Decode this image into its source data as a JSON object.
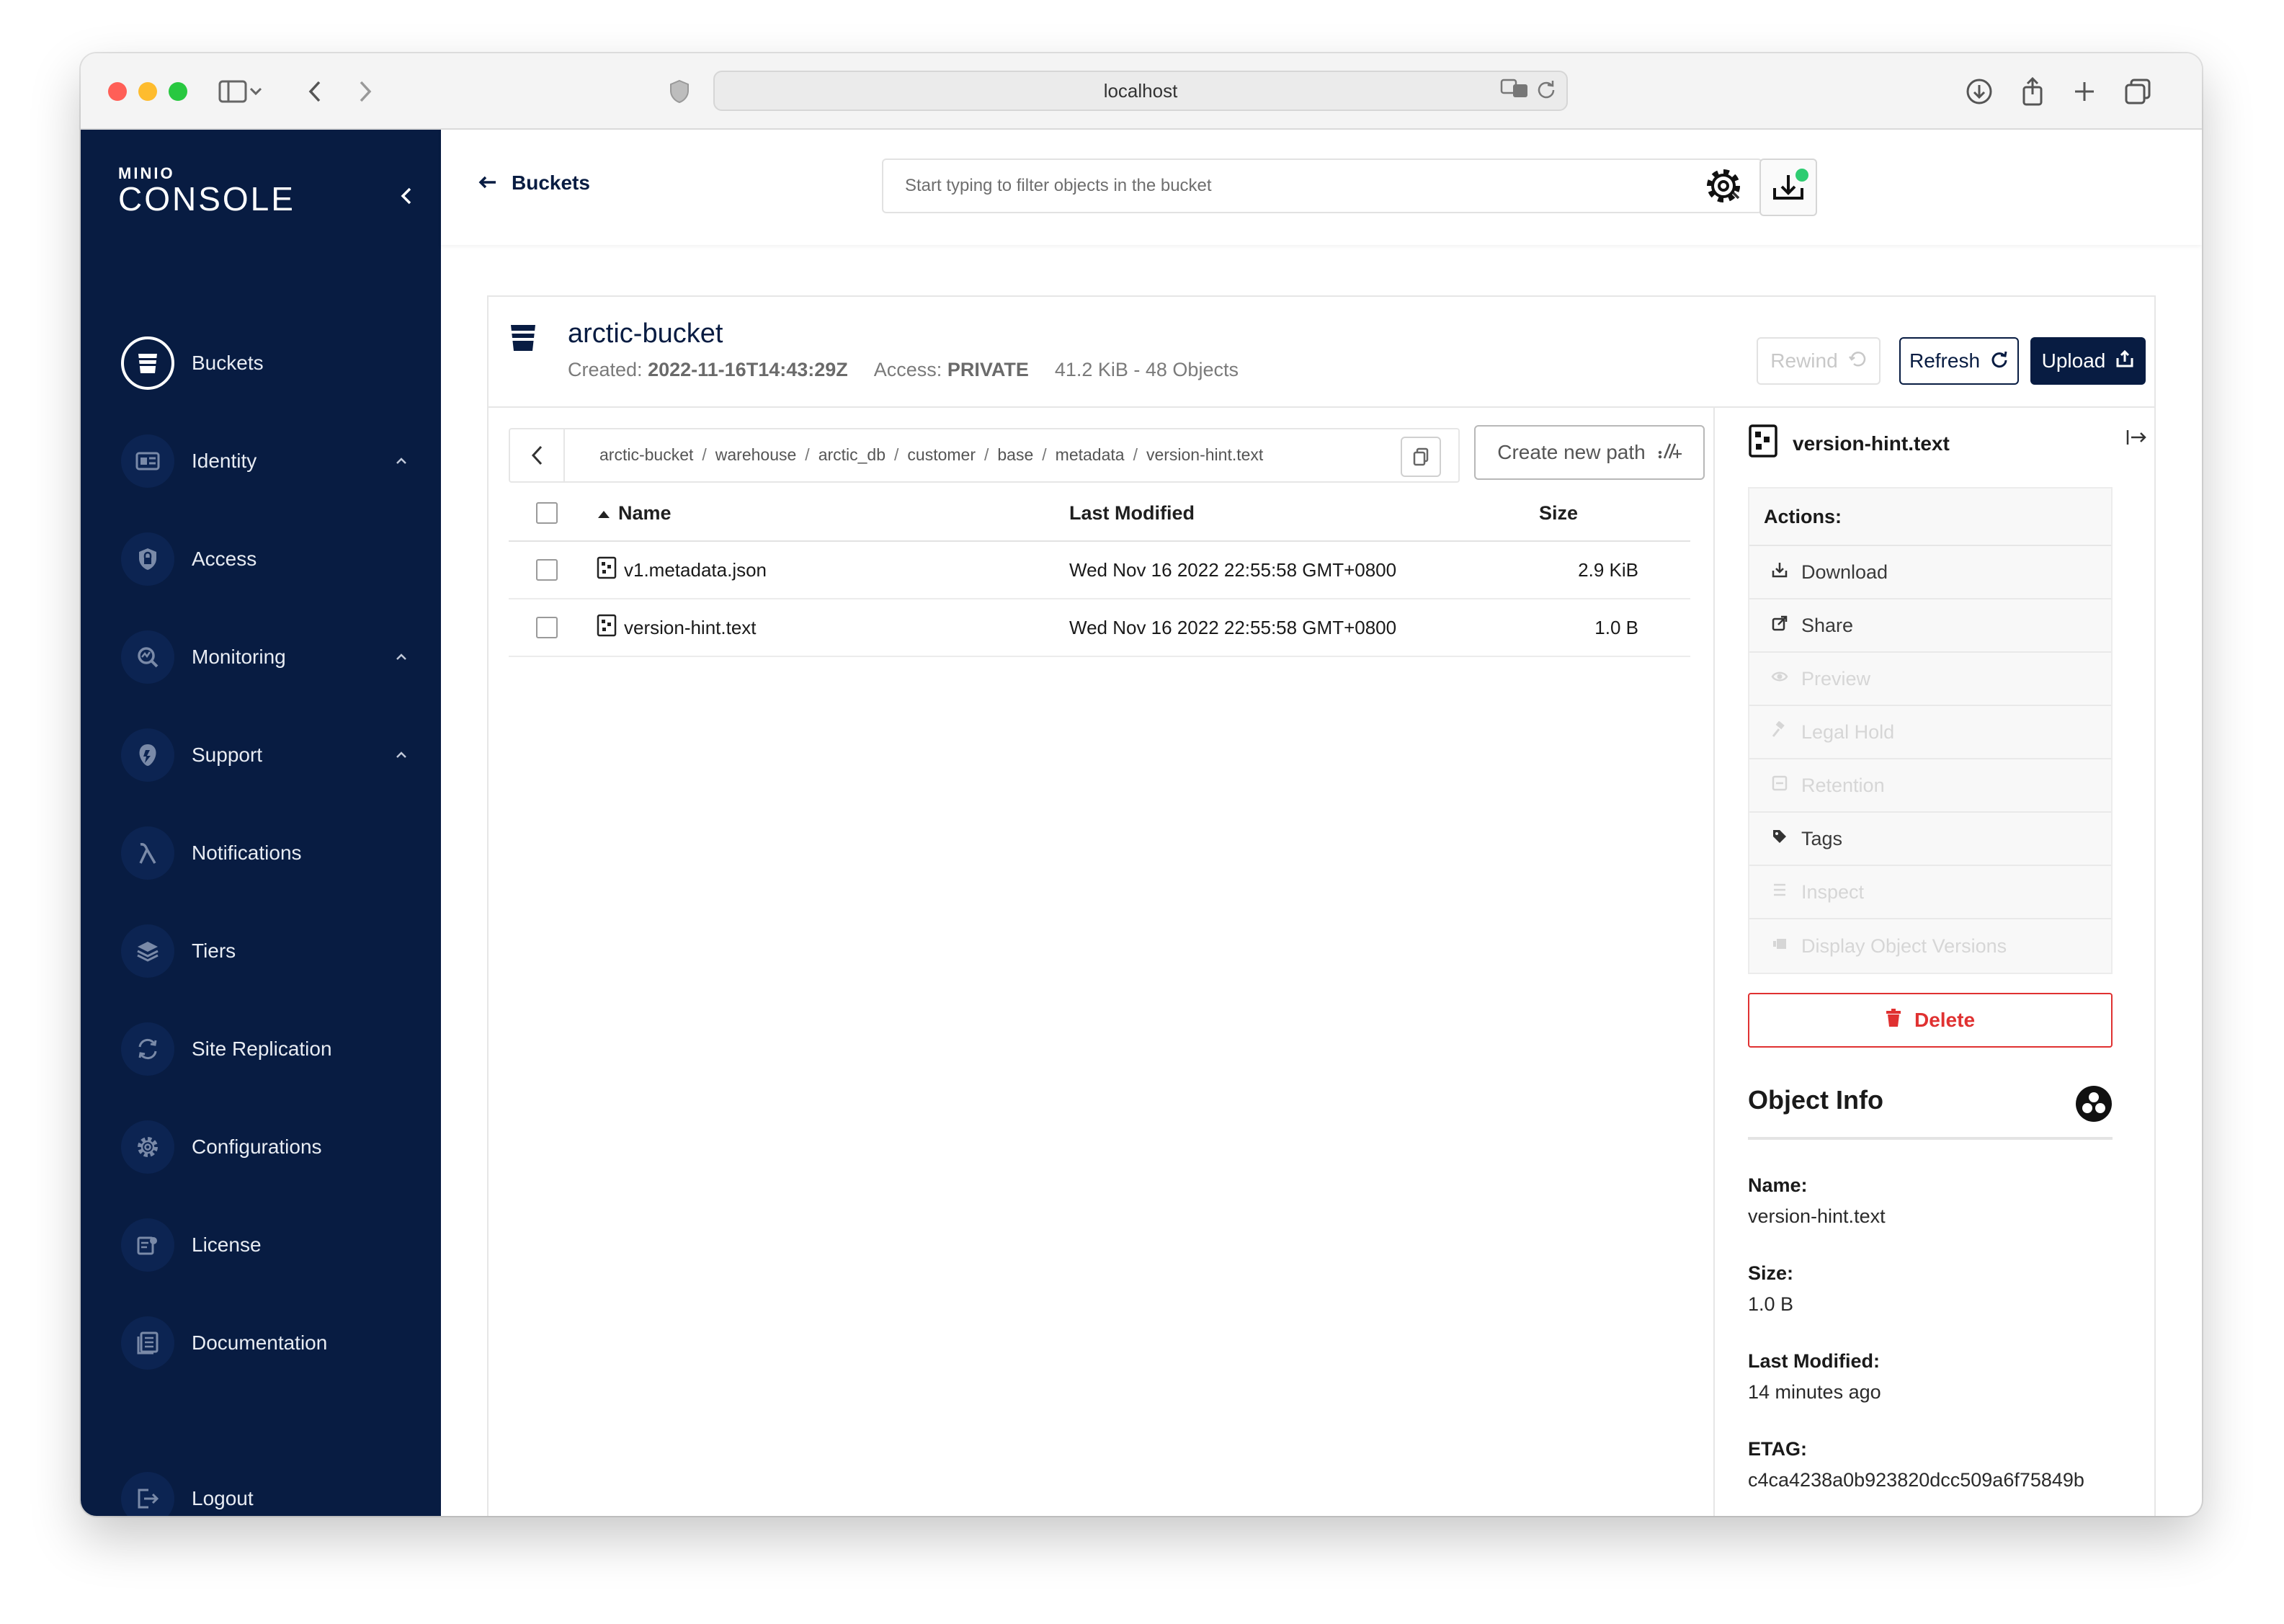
{
  "browser": {
    "url": "localhost"
  },
  "sidebar": {
    "logo_top": "MINIO",
    "logo_main": "CONSOLE",
    "items": [
      {
        "label": "Buckets",
        "icon": "bucket-icon",
        "active": true
      },
      {
        "label": "Identity",
        "icon": "id-card-icon",
        "expandable": true
      },
      {
        "label": "Access",
        "icon": "lock-shield-icon"
      },
      {
        "label": "Monitoring",
        "icon": "monitoring-icon",
        "expandable": true
      },
      {
        "label": "Support",
        "icon": "support-icon",
        "expandable": true
      },
      {
        "label": "Notifications",
        "icon": "lambda-icon"
      },
      {
        "label": "Tiers",
        "icon": "tiers-icon"
      },
      {
        "label": "Site Replication",
        "icon": "replication-icon"
      },
      {
        "label": "Configurations",
        "icon": "gear-icon"
      },
      {
        "label": "License",
        "icon": "license-icon"
      },
      {
        "label": "Documentation",
        "icon": "documentation-icon"
      }
    ],
    "logout": "Logout"
  },
  "topbar": {
    "back_label": "Buckets",
    "search_placeholder": "Start typing to filter objects in the bucket"
  },
  "bucket": {
    "name": "arctic-bucket",
    "created_label": "Created:",
    "created_value": "2022-11-16T14:43:29Z",
    "access_label": "Access:",
    "access_value": "PRIVATE",
    "stats": "41.2 KiB - 48 Objects",
    "rewind_label": "Rewind",
    "refresh_label": "Refresh",
    "upload_label": "Upload"
  },
  "breadcrumb": {
    "segments": [
      "arctic-bucket",
      "warehouse",
      "arctic_db",
      "customer",
      "base",
      "metadata",
      "version-hint.text"
    ],
    "separator": "/",
    "new_path_label": "Create new path"
  },
  "table": {
    "headers": {
      "name": "Name",
      "modified": "Last Modified",
      "size": "Size"
    },
    "rows": [
      {
        "name": "v1.metadata.json",
        "modified": "Wed Nov 16 2022 22:55:58 GMT+0800",
        "size": "2.9 KiB"
      },
      {
        "name": "version-hint.text",
        "modified": "Wed Nov 16 2022 22:55:58 GMT+0800",
        "size": "1.0 B"
      }
    ]
  },
  "panel": {
    "title": "version-hint.text",
    "actions_title": "Actions:",
    "actions": [
      {
        "label": "Download",
        "icon": "download-icon",
        "enabled": true
      },
      {
        "label": "Share",
        "icon": "share-icon",
        "enabled": true
      },
      {
        "label": "Preview",
        "icon": "eye-icon",
        "enabled": false
      },
      {
        "label": "Legal Hold",
        "icon": "gavel-icon",
        "enabled": false
      },
      {
        "label": "Retention",
        "icon": "retention-icon",
        "enabled": false
      },
      {
        "label": "Tags",
        "icon": "tag-icon",
        "enabled": true
      },
      {
        "label": "Inspect",
        "icon": "inspect-icon",
        "enabled": false
      },
      {
        "label": "Display Object Versions",
        "icon": "versions-icon",
        "enabled": false
      }
    ],
    "delete_label": "Delete",
    "object_info_title": "Object Info",
    "info": [
      {
        "label": "Name:",
        "value": "version-hint.text"
      },
      {
        "label": "Size:",
        "value": "1.0 B"
      },
      {
        "label": "Last Modified:",
        "value": "14 minutes ago"
      },
      {
        "label": "ETAG:",
        "value": "c4ca4238a0b923820dcc509a6f75849b"
      }
    ]
  },
  "colors": {
    "sidebar_bg": "#081c42",
    "primary": "#081c42",
    "danger": "#e03131",
    "status_dot": "#2ecc71"
  }
}
